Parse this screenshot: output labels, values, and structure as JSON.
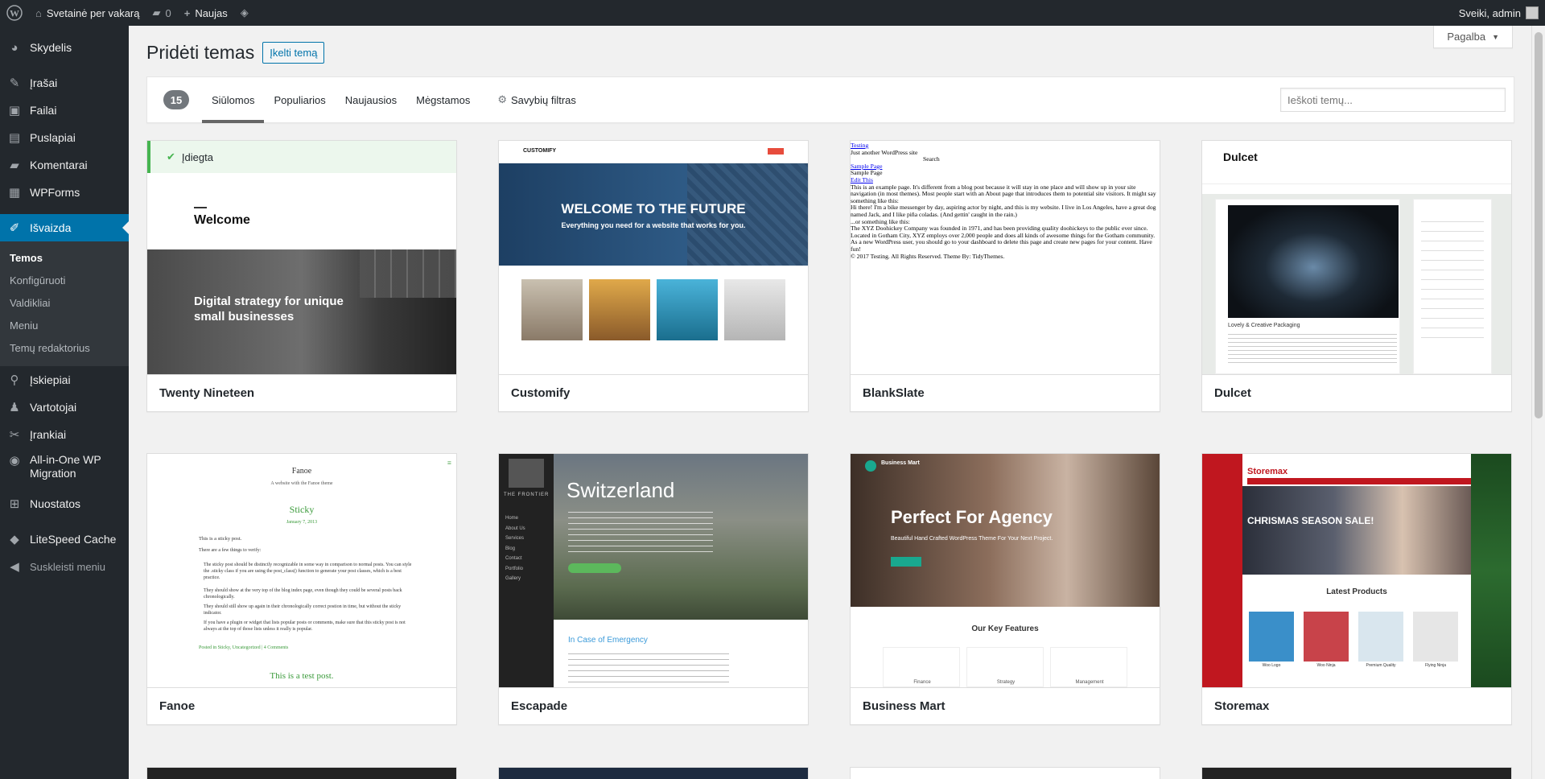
{
  "admin_bar": {
    "site_name": "Svetainė per vakarą",
    "comments_count": "0",
    "new_label": "Naujas",
    "greeting": "Sveiki, admin"
  },
  "sidebar": {
    "items": [
      {
        "label": "Skydelis",
        "icon": "dashboard-icon"
      },
      {
        "label": "Įrašai",
        "icon": "pin-icon"
      },
      {
        "label": "Failai",
        "icon": "media-icon"
      },
      {
        "label": "Puslapiai",
        "icon": "page-icon"
      },
      {
        "label": "Komentarai",
        "icon": "comment-icon"
      },
      {
        "label": "WPForms",
        "icon": "forms-icon"
      },
      {
        "label": "Išvaizda",
        "icon": "brush-icon"
      },
      {
        "label": "Įskiepiai",
        "icon": "plugin-icon"
      },
      {
        "label": "Vartotojai",
        "icon": "user-icon"
      },
      {
        "label": "Įrankiai",
        "icon": "wrench-icon"
      },
      {
        "label": "All-in-One WP Migration",
        "icon": "migration-icon"
      },
      {
        "label": "Nuostatos",
        "icon": "settings-icon"
      },
      {
        "label": "LiteSpeed Cache",
        "icon": "litespeed-icon"
      },
      {
        "label": "Suskleisti meniu",
        "icon": "collapse-icon"
      }
    ],
    "submenu": [
      "Temos",
      "Konfigūruoti",
      "Valdikliai",
      "Meniu",
      "Temų redaktorius"
    ]
  },
  "page": {
    "title": "Pridėti temas",
    "upload_button": "Įkelti temą",
    "help_tab": "Pagalba"
  },
  "filter": {
    "count": "15",
    "tabs": [
      "Siūlomos",
      "Populiarios",
      "Naujausios",
      "Mėgstamos"
    ],
    "feature_filter": "Savybių filtras",
    "search_placeholder": "Ieškoti temų..."
  },
  "themes": [
    {
      "name": "Twenty Nineteen",
      "installed_label": "Įdiegta",
      "preview": {
        "welcome": "Welcome",
        "headline": "Digital strategy for unique small businesses"
      }
    },
    {
      "name": "Customify",
      "preview": {
        "logo": "CUSTOMIFY",
        "title": "WELCOME TO THE FUTURE",
        "subtitle": "Everything you need for a website that works for you."
      }
    },
    {
      "name": "BlankSlate",
      "preview": {
        "lines": [
          "Testing",
          "Just another WordPress site",
          "Search",
          "Sample Page",
          "Sample Page",
          "Edit This",
          "This is an example page. It's different from a blog post because it will stay in one place and will show up in your site navigation (in most themes). Most people start with an About page that introduces them to potential site visitors. It might say something like this:",
          "Hi there! I'm a bike messenger by day, aspiring actor by night, and this is my website. I live in Los Angeles, have a great dog named Jack, and I like piña coladas. (And gettin' caught in the rain.)",
          "...or something like this:",
          "The XYZ Doohickey Company was founded in 1971, and has been providing quality doohickeys to the public ever since. Located in Gotham City, XYZ employs over 2,000 people and does all kinds of awesome things for the Gotham community.",
          "As a new WordPress user, you should go to your dashboard to delete this page and create new pages for your content. Have fun!",
          "© 2017 Testing. All Rights Reserved. Theme By: TidyThemes."
        ]
      }
    },
    {
      "name": "Dulcet",
      "preview": {
        "title": "Dulcet",
        "caption": "Lovely & Creative Packaging"
      }
    },
    {
      "name": "Fanoe",
      "preview": {
        "site": "Fanoe",
        "tagline": "A website with the Fanoe theme",
        "post_title": "Sticky",
        "post_date": "January 7, 2013",
        "intro": "This is a sticky post.",
        "lines": [
          "There are a few things to verify:",
          "The sticky post should be distinctly recognizable in some way in comparison to normal posts. You can style the .sticky class if you are using the post_class() function to generate your post classes, which is a best practice.",
          "They should show at the very top of the blog index page, even though they could be several posts back chronologically.",
          "They should still show up again in their chronologically correct postion in time, but without the sticky indicator.",
          "If you have a plugin or widget that lists popular posts or comments, make sure that this sticky post is not always at the top of those lists unless it really is popular."
        ],
        "posted": "Posted in Sticky, Uncategorized | 4 Comments",
        "next": "This is a test post."
      }
    },
    {
      "name": "Escapade",
      "preview": {
        "title": "Switzerland",
        "sidebar_brand": "THE FRONTIER",
        "menu": [
          "Home",
          "About Us",
          "Services",
          "Blog",
          "Contact",
          "Portfolio",
          "Gallery"
        ],
        "lower_title": "In Case of Emergency"
      }
    },
    {
      "name": "Business Mart",
      "preview": {
        "logo": "Business Mart",
        "headline": "Perfect For Agency",
        "sub": "Beautiful Hand Crafted WordPress Theme For Your Next Project.",
        "features_title": "Our Key Features",
        "features": [
          "Finance",
          "Strategy",
          "Management"
        ]
      }
    },
    {
      "name": "Storemax",
      "preview": {
        "logo": "Storemax",
        "sale": "CHRISMAS SEASON SALE!",
        "latest": "Latest Products",
        "products": [
          "Woo Logo",
          "Woo Ninja",
          "Premium Quality",
          "Flying Ninja"
        ]
      }
    }
  ],
  "colors": {
    "admin_bg": "#23282d",
    "accent": "#0073aa",
    "installed_green": "#46b450"
  }
}
